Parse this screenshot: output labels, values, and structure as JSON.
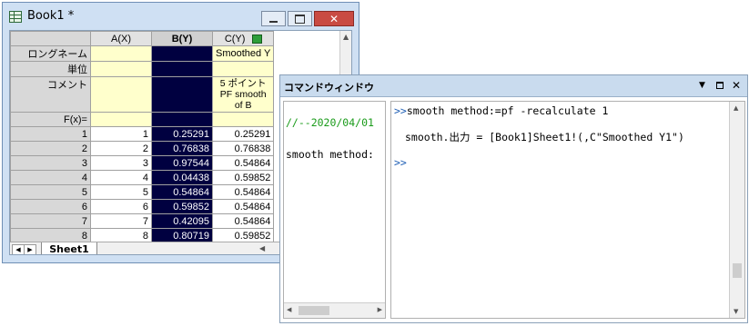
{
  "book": {
    "title": "Book1 *",
    "col_headers": [
      "A(X)",
      "B(Y)",
      "C(Y)"
    ],
    "row_labels": {
      "long_name": "ロングネーム",
      "unit": "単位",
      "comment": "コメント",
      "fx": "F(x)="
    },
    "c_long_name": "Smoothed Y",
    "c_comment": [
      "5 ポイント",
      "PF smooth",
      "of B"
    ],
    "rows": [
      {
        "n": "1",
        "a": "1",
        "b": "0.25291",
        "c": "0.25291"
      },
      {
        "n": "2",
        "a": "2",
        "b": "0.76838",
        "c": "0.76838"
      },
      {
        "n": "3",
        "a": "3",
        "b": "0.97544",
        "c": "0.54864"
      },
      {
        "n": "4",
        "a": "4",
        "b": "0.04438",
        "c": "0.59852"
      },
      {
        "n": "5",
        "a": "5",
        "b": "0.54864",
        "c": "0.54864"
      },
      {
        "n": "6",
        "a": "6",
        "b": "0.59852",
        "c": "0.54864"
      },
      {
        "n": "7",
        "a": "7",
        "b": "0.42095",
        "c": "0.54864"
      },
      {
        "n": "8",
        "a": "8",
        "b": "0.80719",
        "c": "0.59852"
      }
    ],
    "sheet_tab": "Sheet1"
  },
  "cmd": {
    "title": "コマンドウィンドウ",
    "history": [
      "//--2020/04/01",
      "smooth method:"
    ],
    "prompt1": ">>",
    "command": "smooth method:=pf -recalculate 1",
    "output": "smooth.出力 = [Book1]Sheet1!(,C\"Smoothed Y1\")",
    "prompt2": ">>"
  }
}
